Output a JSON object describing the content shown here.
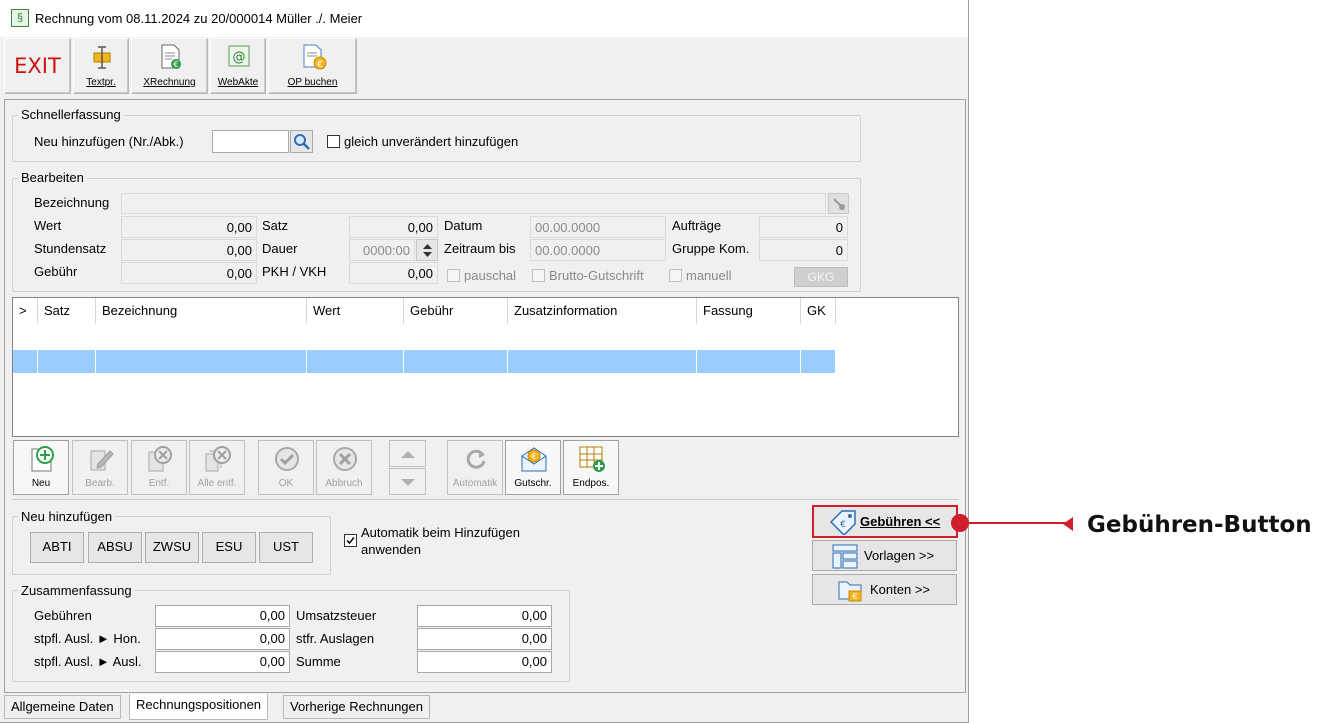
{
  "window": {
    "title": "Rechnung vom 08.11.2024 zu 20/000014  Müller ./. Meier"
  },
  "toolbar": {
    "exit": "EXIT",
    "textpr": "Textpr.",
    "xrechnung": "XRechnung",
    "webakte": "WebAkte",
    "op_buchen": "OP buchen"
  },
  "schnellerfassung": {
    "legend": "Schnellerfassung",
    "neu_label": "Neu hinzufügen (Nr./Abk.)",
    "neu_value": "",
    "gleich_label": "gleich unverändert hinzufügen"
  },
  "bearbeiten": {
    "legend": "Bearbeiten",
    "bezeichnung_label": "Bezeichnung",
    "bezeichnung_value": "",
    "wert_label": "Wert",
    "wert_value": "0,00",
    "stundensatz_label": "Stundensatz",
    "stundensatz_value": "0,00",
    "gebuehr_label": "Gebühr",
    "gebuehr_value": "0,00",
    "satz_label": "Satz",
    "satz_value": "0,00",
    "dauer_label": "Dauer",
    "dauer_value": "0000:00",
    "pkh_label": "PKH / VKH",
    "pkh_value": "0,00",
    "datum_label": "Datum",
    "datum_value": "00.00.0000",
    "zeitraum_label": "Zeitraum bis",
    "zeitraum_value": "00.00.0000",
    "pauschal_label": "pauschal",
    "brutto_label": "Brutto-Gutschrift",
    "auftraege_label": "Aufträge",
    "auftraege_value": "0",
    "gruppe_label": "Gruppe Kom.",
    "gruppe_value": "0",
    "manuell_label": "manuell",
    "gkg_label": "GKG"
  },
  "grid": {
    "columns": [
      ">",
      "Satz",
      "Bezeichnung",
      "Wert",
      "Gebühr",
      "Zusatzinformation",
      "Fassung",
      "GK"
    ]
  },
  "actions": {
    "neu": "Neu",
    "bearb": "Bearb.",
    "entf": "Entf.",
    "alle_entf": "Alle entf.",
    "ok": "OK",
    "abbruch": "Abbruch",
    "automatik": "Automatik",
    "gutschr": "Gutschr.",
    "endpos": "Endpos."
  },
  "neu_hinzufuegen": {
    "legend": "Neu hinzufügen",
    "buttons": [
      "ABTI",
      "ABSU",
      "ZWSU",
      "ESU",
      "UST"
    ],
    "automatik_line1": "Automatik beim Hinzufügen",
    "automatik_line2": "anwenden"
  },
  "zusammenfassung": {
    "legend": "Zusammenfassung",
    "gebuehren_label": "Gebühren",
    "gebuehren_value": "0,00",
    "stpfl_hon_label": "stpfl. Ausl. ► Hon.",
    "stpfl_hon_value": "0,00",
    "stpfl_ausl_label": "stpfl. Ausl. ► Ausl.",
    "stpfl_ausl_value": "0,00",
    "ust_label": "Umsatzsteuer",
    "ust_value": "0,00",
    "stfr_label": "stfr. Auslagen",
    "stfr_value": "0,00",
    "summe_label": "Summe",
    "summe_value": "0,00"
  },
  "side": {
    "gebuehren": "Gebühren <<",
    "vorlagen": "Vorlagen >>",
    "konten": "Konten >>"
  },
  "tabs": [
    "Allgemeine Daten",
    "Rechnungspositionen",
    "Vorherige Rechnungen"
  ],
  "callout": {
    "text": "Gebühren-Button",
    "color": "#d01f2c"
  }
}
